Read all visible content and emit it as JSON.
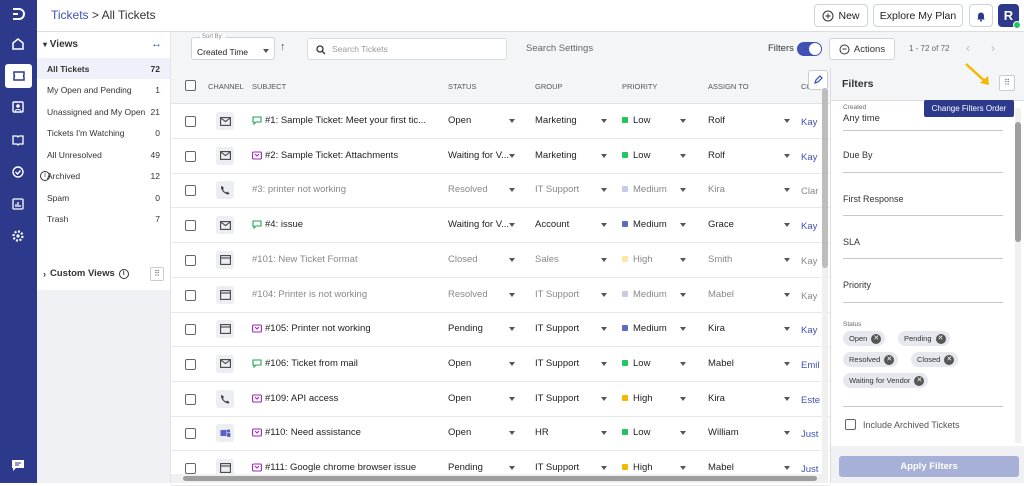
{
  "colors": {
    "rail": "#2d3a8c",
    "accent": "#3f51b5",
    "low": "#22c55e",
    "medium": "#5c6bc0",
    "high": "#f5b800"
  },
  "breadcrumb": {
    "root": "Tickets",
    "separator": " > ",
    "current": "All Tickets"
  },
  "topbar": {
    "new_label": "New",
    "explore_label": "Explore My Plan",
    "avatar_letter": "R"
  },
  "views": {
    "title": "Views",
    "items": [
      {
        "label": "All Tickets",
        "count": "72"
      },
      {
        "label": "My Open and Pending",
        "count": "1"
      },
      {
        "label": "Unassigned and My Open",
        "count": "21"
      },
      {
        "label": "Tickets I'm Watching",
        "count": "0"
      },
      {
        "label": "All Unresolved",
        "count": "49"
      },
      {
        "label": "Archived",
        "count": "12"
      },
      {
        "label": "Spam",
        "count": "0"
      },
      {
        "label": "Trash",
        "count": "7"
      }
    ],
    "custom_title": "Custom Views"
  },
  "toolbar": {
    "sort_label": "Sort By:",
    "sort_value": "Created Time",
    "search_placeholder": "Search Tickets",
    "search_settings": "Search Settings",
    "filters_label": "Filters",
    "actions_label": "Actions",
    "page_info": "1 - 72 of 72"
  },
  "columns": {
    "channel": "CHANNEL",
    "subject": "SUBJECT",
    "status": "STATUS",
    "group": "GROUP",
    "priority": "PRIORITY",
    "assign": "ASSIGN TO",
    "contact": "CO"
  },
  "tickets": [
    {
      "channel": "mail",
      "tag": "green",
      "subject": "#1: Sample Ticket: Meet your first tic...",
      "status": "Open",
      "group": "Marketing",
      "priority": "Low",
      "agent": "Rolf",
      "contact": "Kay",
      "muted": false
    },
    {
      "channel": "mail",
      "tag": "purple",
      "subject": "#2: Sample Ticket: Attachments",
      "status": "Waiting for V...",
      "group": "Marketing",
      "priority": "Low",
      "agent": "Rolf",
      "contact": "Kay",
      "muted": false
    },
    {
      "channel": "phone",
      "tag": "",
      "subject": "#3: printer not working",
      "status": "Resolved",
      "group": "IT Support",
      "priority": "Medium",
      "agent": "Kira",
      "contact": "Clar",
      "muted": true
    },
    {
      "channel": "mail",
      "tag": "green",
      "subject": "#4: issue",
      "status": "Waiting for V...",
      "group": "Account",
      "priority": "Medium",
      "agent": "Grace",
      "contact": "Kay",
      "muted": false
    },
    {
      "channel": "form",
      "tag": "",
      "subject": "#101: New Ticket Format",
      "status": "Closed",
      "group": "Sales",
      "priority": "High",
      "agent": "Smith",
      "contact": "Kay",
      "muted": true
    },
    {
      "channel": "form",
      "tag": "",
      "subject": "#104: Printer is not working",
      "status": "Resolved",
      "group": "IT Support",
      "priority": "Medium",
      "agent": "Mabel",
      "contact": "Kay",
      "muted": true
    },
    {
      "channel": "form",
      "tag": "purple",
      "subject": "#105: Printer not working",
      "status": "Pending",
      "group": "IT Support",
      "priority": "Medium",
      "agent": "Kira",
      "contact": "Kay",
      "muted": false
    },
    {
      "channel": "mail",
      "tag": "green",
      "subject": "#106: Ticket from mail",
      "status": "Open",
      "group": "IT Support",
      "priority": "Low",
      "agent": "Mabel",
      "contact": "Emil",
      "muted": false
    },
    {
      "channel": "phone",
      "tag": "purple",
      "subject": "#109: API access",
      "status": "Open",
      "group": "IT Support",
      "priority": "High",
      "agent": "Kira",
      "contact": "Este",
      "muted": false
    },
    {
      "channel": "teams",
      "tag": "purple",
      "subject": "#110: Need assistance",
      "status": "Open",
      "group": "HR",
      "priority": "Low",
      "agent": "William",
      "contact": "Just",
      "muted": false
    },
    {
      "channel": "form",
      "tag": "purple",
      "subject": "#111: Google chrome browser issue",
      "status": "Pending",
      "group": "IT Support",
      "priority": "High",
      "agent": "Mabel",
      "contact": "Just",
      "muted": false
    }
  ],
  "filters": {
    "title": "Filters",
    "created_label": "Created",
    "created_value": "Any time",
    "due_by": "Due By",
    "first_response": "First Response",
    "sla": "SLA",
    "priority": "Priority",
    "status_label": "Status",
    "status_chips": [
      "Open",
      "Pending",
      "Resolved",
      "Closed",
      "Waiting for Vendor"
    ],
    "include_archived": "Include Archived Tickets",
    "apply_label": "Apply Filters",
    "change_order_tooltip": "Change Filters Order"
  }
}
